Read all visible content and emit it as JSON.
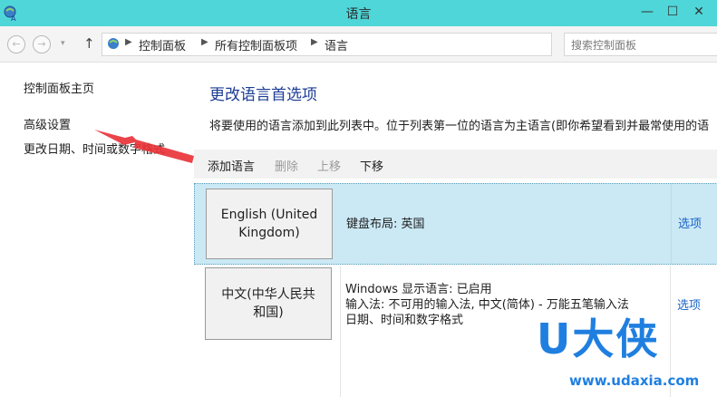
{
  "window": {
    "title": "语言",
    "minimize": "—",
    "maximize": "☐",
    "close": "✕"
  },
  "nav": {
    "back": "←",
    "forward": "→",
    "history": "▾",
    "up": "↑"
  },
  "address": {
    "crumbs": [
      "控制面板",
      "所有控制面板项",
      "语言"
    ],
    "dropdown": "▾",
    "refresh": "⟳"
  },
  "search": {
    "placeholder": "搜索控制面板"
  },
  "left_pane": {
    "links": [
      "控制面板主页",
      "高级设置",
      "更改日期、时间或数字格式"
    ]
  },
  "main": {
    "heading": "更改语言首选项",
    "description": "将要使用的语言添加到此列表中。位于列表第一位的语言为主语言(即你希望看到并最常使用的语",
    "toolbar": {
      "add": "添加语言",
      "remove": "删除",
      "move_up": "上移",
      "move_down": "下移"
    },
    "languages": [
      {
        "name_line1": "English (United",
        "name_line2": "Kingdom)",
        "info": [
          "键盘布局: 英国"
        ],
        "options": "选项"
      },
      {
        "name_line1": "中文(中华人民共",
        "name_line2": "和国)",
        "info": [
          "Windows 显示语言: 已启用",
          "输入法: 不可用的输入法, 中文(简体) - 万能五笔输入法",
          "日期、时间和数字格式"
        ],
        "options": "选项"
      }
    ]
  },
  "watermark": {
    "brand": "U大侠",
    "url": "www.udaxia.com"
  },
  "colors": {
    "titlebar": "#4fd6d8",
    "heading": "#1c3d94",
    "link": "#1a63c6",
    "selected_row": "#cbe9f5",
    "annotation_arrow": "#e8343a",
    "watermark": "#1f7fe0"
  }
}
